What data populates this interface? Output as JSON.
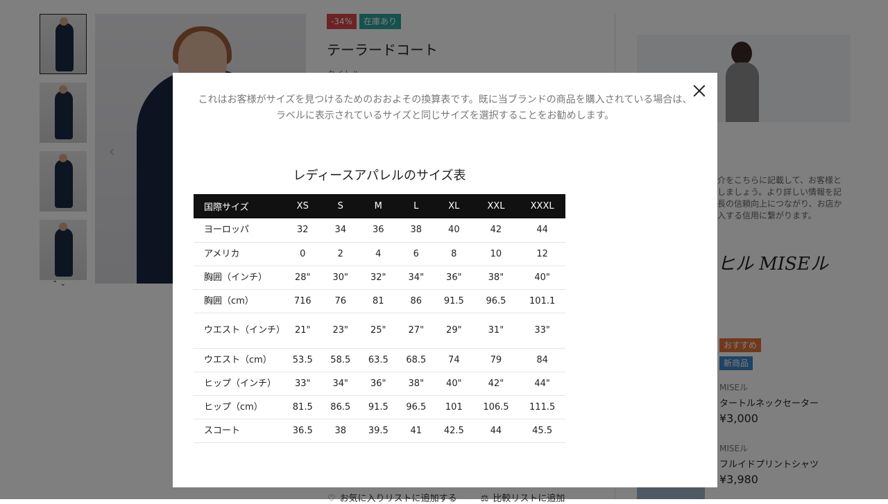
{
  "product": {
    "discount_badge": "-34%",
    "stock_badge": "在庫あり",
    "title": "テーラードコート",
    "subtitle": "タイトル"
  },
  "sidebar": {
    "description": "介をこちらに記載して、お客様と\nしましょう。より詳しい情報を記\n長の信頼向上につながり、お店か\n入する信用に繋がります。",
    "logo_text": "ヒル MISEル",
    "tags": {
      "recommended": "おすすめ",
      "new": "新商品"
    },
    "items": [
      {
        "brand": "MISEル",
        "name": "タートルネックセーター",
        "price": "¥3,000"
      },
      {
        "brand": "MISEル",
        "name": "フルイドプリントシャツ",
        "price": "¥3,980"
      }
    ]
  },
  "actions": {
    "wishlist": "お気に入りリストに追加する",
    "compare": "比較リストに追加"
  },
  "modal": {
    "note": "これはお客様がサイズを見つけるためのおおよその換算表です。既に当ブランドの商品を購入されている場合は、ラベルに表示されているサイズと同じサイズを選択することをお勧めします。",
    "chart_title": "レディースアパレルのサイズ表",
    "headers": [
      "国際サイズ",
      "XS",
      "S",
      "M",
      "L",
      "XL",
      "XXL",
      "XXXL"
    ],
    "rows": [
      [
        "ヨーロッパ",
        "32",
        "34",
        "36",
        "38",
        "40",
        "42",
        "44"
      ],
      [
        "アメリカ",
        "0",
        "2",
        "4",
        "6",
        "8",
        "10",
        "12"
      ],
      [
        "胸囲（インチ）",
        "28\"",
        "30\"",
        "32\"",
        "34\"",
        "36\"",
        "38\"",
        "40\""
      ],
      [
        "胸囲（cm）",
        "716",
        "76",
        "81",
        "86",
        "91.5",
        "96.5",
        "101.1"
      ],
      [
        "ウエスト（インチ）",
        "21\"",
        "23\"",
        "25\"",
        "27\"",
        "29\"",
        "31\"",
        "33\""
      ],
      [
        "ウエスト（cm）",
        "53.5",
        "58.5",
        "63.5",
        "68.5",
        "74",
        "79",
        "84"
      ],
      [
        "ヒップ（インチ）",
        "33\"",
        "34\"",
        "36\"",
        "38\"",
        "40\"",
        "42\"",
        "44\""
      ],
      [
        "ヒップ（cm）",
        "81.5",
        "86.5",
        "91.5",
        "96.5",
        "101",
        "106.5",
        "111.5"
      ],
      [
        "スコート",
        "36.5",
        "38",
        "39.5",
        "41",
        "42.5",
        "44",
        "45.5"
      ]
    ]
  }
}
